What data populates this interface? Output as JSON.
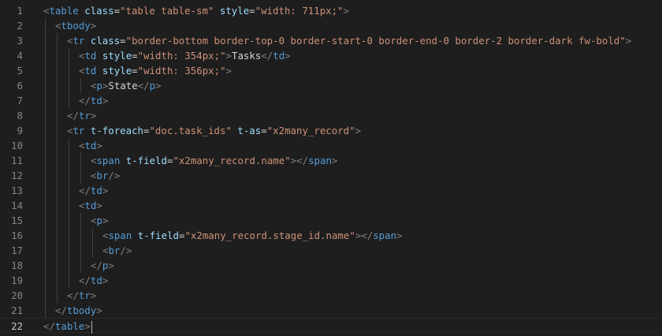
{
  "editor": {
    "language": "xml",
    "active_line": 22,
    "lines": [
      {
        "n": "1",
        "indent": 0,
        "tokens": [
          [
            "punct",
            "<"
          ],
          [
            "tag",
            "table"
          ],
          [
            "txt",
            " "
          ],
          [
            "attr",
            "class"
          ],
          [
            "txt",
            "="
          ],
          [
            "str",
            "\"table table-sm\""
          ],
          [
            "txt",
            " "
          ],
          [
            "attr",
            "style"
          ],
          [
            "txt",
            "="
          ],
          [
            "str",
            "\"width: 711px;\""
          ],
          [
            "punct",
            ">"
          ]
        ]
      },
      {
        "n": "2",
        "indent": 1,
        "tokens": [
          [
            "punct",
            "<"
          ],
          [
            "tag",
            "tbody"
          ],
          [
            "punct",
            ">"
          ]
        ]
      },
      {
        "n": "3",
        "indent": 2,
        "tokens": [
          [
            "punct",
            "<"
          ],
          [
            "tag",
            "tr"
          ],
          [
            "txt",
            " "
          ],
          [
            "attr",
            "class"
          ],
          [
            "txt",
            "="
          ],
          [
            "str",
            "\"border-bottom border-top-0 border-start-0 border-end-0 border-2 border-dark fw-bold\""
          ],
          [
            "punct",
            ">"
          ]
        ]
      },
      {
        "n": "4",
        "indent": 3,
        "tokens": [
          [
            "punct",
            "<"
          ],
          [
            "tag",
            "td"
          ],
          [
            "txt",
            " "
          ],
          [
            "attr",
            "style"
          ],
          [
            "txt",
            "="
          ],
          [
            "str",
            "\"width: 354px;\""
          ],
          [
            "punct",
            ">"
          ],
          [
            "txt",
            "Tasks"
          ],
          [
            "punct",
            "</"
          ],
          [
            "tag",
            "td"
          ],
          [
            "punct",
            ">"
          ]
        ]
      },
      {
        "n": "5",
        "indent": 3,
        "tokens": [
          [
            "punct",
            "<"
          ],
          [
            "tag",
            "td"
          ],
          [
            "txt",
            " "
          ],
          [
            "attr",
            "style"
          ],
          [
            "txt",
            "="
          ],
          [
            "str",
            "\"width: 356px;\""
          ],
          [
            "punct",
            ">"
          ]
        ]
      },
      {
        "n": "6",
        "indent": 4,
        "tokens": [
          [
            "punct",
            "<"
          ],
          [
            "tag",
            "p"
          ],
          [
            "punct",
            ">"
          ],
          [
            "txt",
            "State"
          ],
          [
            "punct",
            "</"
          ],
          [
            "tag",
            "p"
          ],
          [
            "punct",
            ">"
          ]
        ]
      },
      {
        "n": "7",
        "indent": 3,
        "tokens": [
          [
            "punct",
            "</"
          ],
          [
            "tag",
            "td"
          ],
          [
            "punct",
            ">"
          ]
        ]
      },
      {
        "n": "8",
        "indent": 2,
        "tokens": [
          [
            "punct",
            "</"
          ],
          [
            "tag",
            "tr"
          ],
          [
            "punct",
            ">"
          ]
        ]
      },
      {
        "n": "9",
        "indent": 2,
        "tokens": [
          [
            "punct",
            "<"
          ],
          [
            "tag",
            "tr"
          ],
          [
            "txt",
            " "
          ],
          [
            "attr",
            "t-foreach"
          ],
          [
            "txt",
            "="
          ],
          [
            "str",
            "\"doc.task_ids\""
          ],
          [
            "txt",
            " "
          ],
          [
            "attr",
            "t-as"
          ],
          [
            "txt",
            "="
          ],
          [
            "str",
            "\"x2many_record\""
          ],
          [
            "punct",
            ">"
          ]
        ]
      },
      {
        "n": "10",
        "indent": 3,
        "tokens": [
          [
            "punct",
            "<"
          ],
          [
            "tag",
            "td"
          ],
          [
            "punct",
            ">"
          ]
        ]
      },
      {
        "n": "11",
        "indent": 4,
        "tokens": [
          [
            "punct",
            "<"
          ],
          [
            "tag",
            "span"
          ],
          [
            "txt",
            " "
          ],
          [
            "attr",
            "t-field"
          ],
          [
            "txt",
            "="
          ],
          [
            "str",
            "\"x2many_record.name\""
          ],
          [
            "punct",
            "></"
          ],
          [
            "tag",
            "span"
          ],
          [
            "punct",
            ">"
          ]
        ]
      },
      {
        "n": "12",
        "indent": 4,
        "tokens": [
          [
            "punct",
            "<"
          ],
          [
            "tag",
            "br"
          ],
          [
            "punct",
            "/>"
          ]
        ]
      },
      {
        "n": "13",
        "indent": 3,
        "tokens": [
          [
            "punct",
            "</"
          ],
          [
            "tag",
            "td"
          ],
          [
            "punct",
            ">"
          ]
        ]
      },
      {
        "n": "14",
        "indent": 3,
        "tokens": [
          [
            "punct",
            "<"
          ],
          [
            "tag",
            "td"
          ],
          [
            "punct",
            ">"
          ]
        ]
      },
      {
        "n": "15",
        "indent": 4,
        "tokens": [
          [
            "punct",
            "<"
          ],
          [
            "tag",
            "p"
          ],
          [
            "punct",
            ">"
          ]
        ]
      },
      {
        "n": "16",
        "indent": 5,
        "tokens": [
          [
            "punct",
            "<"
          ],
          [
            "tag",
            "span"
          ],
          [
            "txt",
            " "
          ],
          [
            "attr",
            "t-field"
          ],
          [
            "txt",
            "="
          ],
          [
            "str",
            "\"x2many_record.stage_id.name\""
          ],
          [
            "punct",
            "></"
          ],
          [
            "tag",
            "span"
          ],
          [
            "punct",
            ">"
          ]
        ]
      },
      {
        "n": "17",
        "indent": 5,
        "tokens": [
          [
            "punct",
            "<"
          ],
          [
            "tag",
            "br"
          ],
          [
            "punct",
            "/>"
          ]
        ]
      },
      {
        "n": "18",
        "indent": 4,
        "tokens": [
          [
            "punct",
            "</"
          ],
          [
            "tag",
            "p"
          ],
          [
            "punct",
            ">"
          ]
        ]
      },
      {
        "n": "19",
        "indent": 3,
        "tokens": [
          [
            "punct",
            "</"
          ],
          [
            "tag",
            "td"
          ],
          [
            "punct",
            ">"
          ]
        ]
      },
      {
        "n": "20",
        "indent": 2,
        "tokens": [
          [
            "punct",
            "</"
          ],
          [
            "tag",
            "tr"
          ],
          [
            "punct",
            ">"
          ]
        ]
      },
      {
        "n": "21",
        "indent": 1,
        "tokens": [
          [
            "punct",
            "</"
          ],
          [
            "tag",
            "tbody"
          ],
          [
            "punct",
            ">"
          ]
        ]
      },
      {
        "n": "22",
        "indent": 0,
        "tokens": [
          [
            "punct",
            "</"
          ],
          [
            "tag",
            "table"
          ],
          [
            "punct",
            ">"
          ]
        ]
      }
    ]
  },
  "colors": {
    "background": "#1e1e1e",
    "tag": "#569cd6",
    "attribute": "#9cdcfe",
    "string": "#ce9178",
    "text": "#d4d4d4",
    "punctuation": "#808080",
    "line_number": "#858585"
  }
}
